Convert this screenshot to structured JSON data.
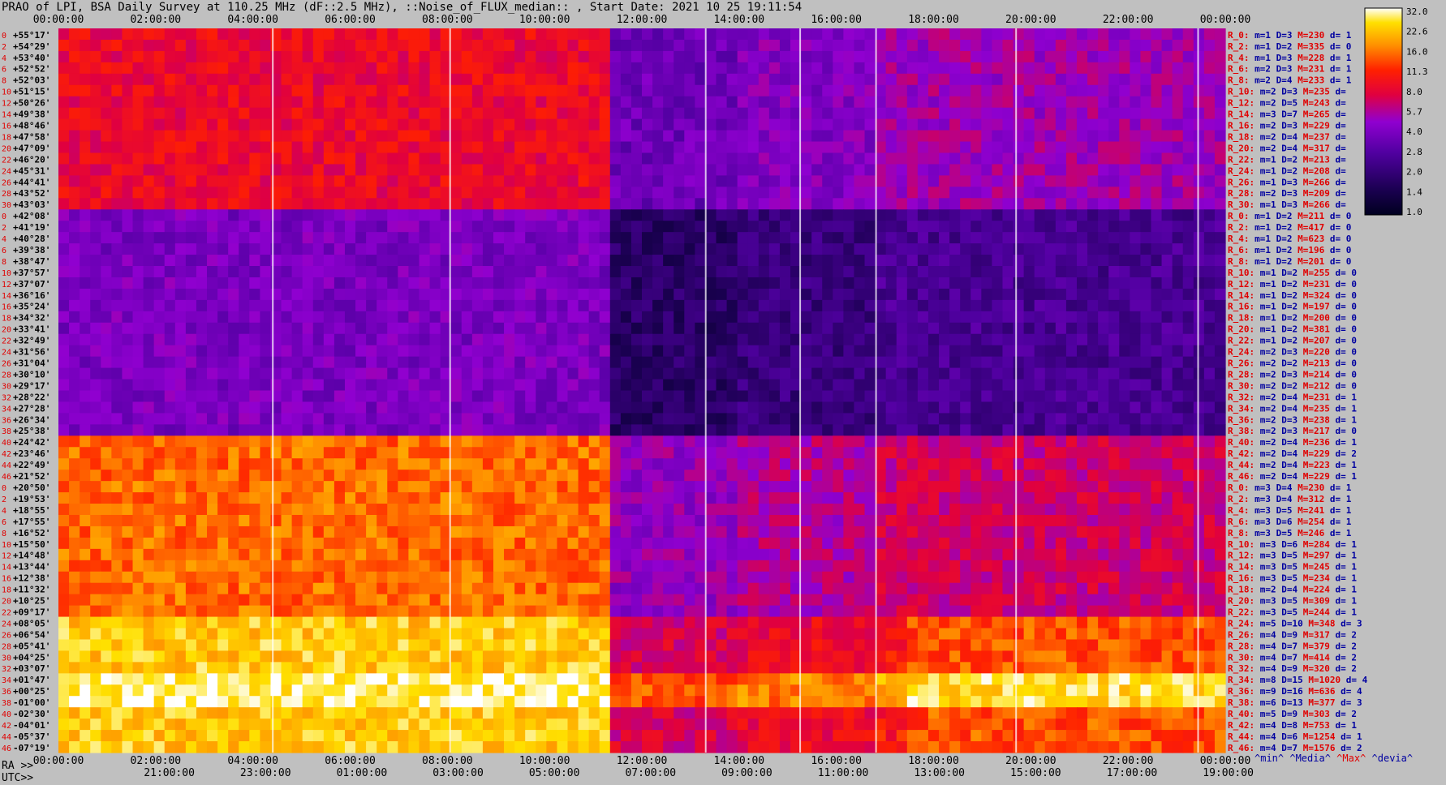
{
  "title": "PRAO of LPI, BSA Daily Survey at 110.25 MHz (dF::2.5 MHz), ::Noise_of_FLUX_median:: , Start Date: 2021 10 25 19:11:54",
  "footer": {
    "ra_label": "RA >>",
    "utc_label": "UTC>>",
    "legend": {
      "min": "^min^",
      "media": "^Media^",
      "max": "^Max^",
      "devia": "^devia^"
    }
  },
  "colors": {
    "background": "#c0c0c0",
    "stat_red": "#e00000",
    "stat_blue": "#0000a0"
  },
  "chart_data": {
    "type": "heatmap",
    "title": "PRAO of LPI, BSA Daily Survey at 110.25 MHz (dF::2.5 MHz), ::Noise_of_FLUX_median:: , Start Date: 2021 10 25 19:11:54",
    "x_top_ticks": [
      "00:00:00",
      "02:00:00",
      "04:00:00",
      "06:00:00",
      "08:00:00",
      "10:00:00",
      "12:00:00",
      "14:00:00",
      "16:00:00",
      "18:00:00",
      "20:00:00",
      "22:00:00",
      "00:00:00"
    ],
    "x_bottom_ra_ticks": [
      "00:00:00",
      "02:00:00",
      "04:00:00",
      "06:00:00",
      "08:00:00",
      "10:00:00",
      "12:00:00",
      "14:00:00",
      "16:00:00",
      "18:00:00",
      "20:00:00",
      "22:00:00",
      "00:00:00"
    ],
    "x_bottom_utc_ticks": [
      "21:00:00",
      "23:00:00",
      "01:00:00",
      "03:00:00",
      "05:00:00",
      "07:00:00",
      "09:00:00",
      "11:00:00",
      "13:00:00",
      "15:00:00",
      "17:00:00",
      "19:00:00"
    ],
    "colorbar": {
      "ticks": [
        "32.0",
        "22.6",
        "16.0",
        "11.3",
        "8.0",
        "5.7",
        "4.0",
        "2.8",
        "2.0",
        "1.4",
        "1.0"
      ],
      "range": [
        1.0,
        32.0
      ]
    },
    "rows": [
      {
        "idx": "0",
        "dec": "+55°17'",
        "R": "R_0:",
        "m": "m=1",
        "D": "D=3",
        "M": "M=230",
        "d": "d= 1",
        "band": 1
      },
      {
        "idx": "2",
        "dec": "+54°29'",
        "R": "R_2:",
        "m": "m=1",
        "D": "D=2",
        "M": "M=335",
        "d": "d= 0",
        "band": 1
      },
      {
        "idx": "4",
        "dec": "+53°40'",
        "R": "R_4:",
        "m": "m=1",
        "D": "D=3",
        "M": "M=228",
        "d": "d= 1",
        "band": 1
      },
      {
        "idx": "6",
        "dec": "+52°52'",
        "R": "R_6:",
        "m": "m=2",
        "D": "D=3",
        "M": "M=231",
        "d": "d= 1",
        "band": 1
      },
      {
        "idx": "8",
        "dec": "+52°03'",
        "R": "R_8:",
        "m": "m=2",
        "D": "D=4",
        "M": "M=233",
        "d": "d= 1",
        "band": 1
      },
      {
        "idx": "10",
        "dec": "+51°15'",
        "R": "R_10:",
        "m": "m=2",
        "D": "D=3",
        "M": "M=235",
        "d": "d=",
        "band": 1
      },
      {
        "idx": "12",
        "dec": "+50°26'",
        "R": "R_12:",
        "m": "m=2",
        "D": "D=5",
        "M": "M=243",
        "d": "d=",
        "band": 1
      },
      {
        "idx": "14",
        "dec": "+49°38'",
        "R": "R_14:",
        "m": "m=3",
        "D": "D=7",
        "M": "M=265",
        "d": "d=",
        "band": 1
      },
      {
        "idx": "16",
        "dec": "+48°46'",
        "R": "R_16:",
        "m": "m=2",
        "D": "D=3",
        "M": "M=229",
        "d": "d=",
        "band": 1
      },
      {
        "idx": "18",
        "dec": "+47°58'",
        "R": "R_18:",
        "m": "m=2",
        "D": "D=4",
        "M": "M=237",
        "d": "d=",
        "band": 1
      },
      {
        "idx": "20",
        "dec": "+47°09'",
        "R": "R_20:",
        "m": "m=2",
        "D": "D=4",
        "M": "M=317",
        "d": "d=",
        "band": 1
      },
      {
        "idx": "22",
        "dec": "+46°20'",
        "R": "R_22:",
        "m": "m=1",
        "D": "D=2",
        "M": "M=213",
        "d": "d=",
        "band": 1
      },
      {
        "idx": "24",
        "dec": "+45°31'",
        "R": "R_24:",
        "m": "m=1",
        "D": "D=2",
        "M": "M=208",
        "d": "d=",
        "band": 1
      },
      {
        "idx": "26",
        "dec": "+44°41'",
        "R": "R_26:",
        "m": "m=1",
        "D": "D=3",
        "M": "M=266",
        "d": "d=",
        "band": 1
      },
      {
        "idx": "28",
        "dec": "+43°52'",
        "R": "R_28:",
        "m": "m=2",
        "D": "D=3",
        "M": "M=209",
        "d": "d=",
        "band": 1
      },
      {
        "idx": "30",
        "dec": "+43°03'",
        "R": "R_30:",
        "m": "m=1",
        "D": "D=3",
        "M": "M=266",
        "d": "d=",
        "band": 1
      },
      {
        "idx": "0",
        "dec": "+42°08'",
        "R": "R_0:",
        "m": "m=1",
        "D": "D=2",
        "M": "M=211",
        "d": "d= 0",
        "band": 2
      },
      {
        "idx": "2",
        "dec": "+41°19'",
        "R": "R_2:",
        "m": "m=1",
        "D": "D=2",
        "M": "M=417",
        "d": "d= 0",
        "band": 2
      },
      {
        "idx": "4",
        "dec": "+40°28'",
        "R": "R_4:",
        "m": "m=1",
        "D": "D=2",
        "M": "M=623",
        "d": "d= 0",
        "band": 2
      },
      {
        "idx": "6",
        "dec": "+39°38'",
        "R": "R_6:",
        "m": "m=1",
        "D": "D=2",
        "M": "M=196",
        "d": "d= 0",
        "band": 2
      },
      {
        "idx": "8",
        "dec": "+38°47'",
        "R": "R_8:",
        "m": "m=1",
        "D": "D=2",
        "M": "M=201",
        "d": "d= 0",
        "band": 2
      },
      {
        "idx": "10",
        "dec": "+37°57'",
        "R": "R_10:",
        "m": "m=1",
        "D": "D=2",
        "M": "M=255",
        "d": "d= 0",
        "band": 2
      },
      {
        "idx": "12",
        "dec": "+37°07'",
        "R": "R_12:",
        "m": "m=1",
        "D": "D=2",
        "M": "M=231",
        "d": "d= 0",
        "band": 2
      },
      {
        "idx": "14",
        "dec": "+36°16'",
        "R": "R_14:",
        "m": "m=1",
        "D": "D=2",
        "M": "M=324",
        "d": "d= 0",
        "band": 2
      },
      {
        "idx": "16",
        "dec": "+35°24'",
        "R": "R_16:",
        "m": "m=1",
        "D": "D=2",
        "M": "M=197",
        "d": "d= 0",
        "band": 2
      },
      {
        "idx": "18",
        "dec": "+34°32'",
        "R": "R_18:",
        "m": "m=1",
        "D": "D=2",
        "M": "M=200",
        "d": "d= 0",
        "band": 2
      },
      {
        "idx": "20",
        "dec": "+33°41'",
        "R": "R_20:",
        "m": "m=1",
        "D": "D=2",
        "M": "M=381",
        "d": "d= 0",
        "band": 2
      },
      {
        "idx": "22",
        "dec": "+32°49'",
        "R": "R_22:",
        "m": "m=1",
        "D": "D=2",
        "M": "M=207",
        "d": "d= 0",
        "band": 2
      },
      {
        "idx": "24",
        "dec": "+31°56'",
        "R": "R_24:",
        "m": "m=2",
        "D": "D=3",
        "M": "M=220",
        "d": "d= 0",
        "band": 2
      },
      {
        "idx": "26",
        "dec": "+31°04'",
        "R": "R_26:",
        "m": "m=2",
        "D": "D=2",
        "M": "M=213",
        "d": "d= 0",
        "band": 2
      },
      {
        "idx": "28",
        "dec": "+30°10'",
        "R": "R_28:",
        "m": "m=2",
        "D": "D=3",
        "M": "M=214",
        "d": "d= 0",
        "band": 2
      },
      {
        "idx": "30",
        "dec": "+29°17'",
        "R": "R_30:",
        "m": "m=2",
        "D": "D=2",
        "M": "M=212",
        "d": "d= 0",
        "band": 2
      },
      {
        "idx": "32",
        "dec": "+28°22'",
        "R": "R_32:",
        "m": "m=2",
        "D": "D=4",
        "M": "M=231",
        "d": "d= 1",
        "band": 2
      },
      {
        "idx": "34",
        "dec": "+27°28'",
        "R": "R_34:",
        "m": "m=2",
        "D": "D=4",
        "M": "M=235",
        "d": "d= 1",
        "band": 2
      },
      {
        "idx": "36",
        "dec": "+26°34'",
        "R": "R_36:",
        "m": "m=2",
        "D": "D=3",
        "M": "M=238",
        "d": "d= 1",
        "band": 2
      },
      {
        "idx": "38",
        "dec": "+25°38'",
        "R": "R_38:",
        "m": "m=2",
        "D": "D=3",
        "M": "M=217",
        "d": "d= 0",
        "band": 2
      },
      {
        "idx": "40",
        "dec": "+24°42'",
        "R": "R_40:",
        "m": "m=2",
        "D": "D=4",
        "M": "M=236",
        "d": "d= 1",
        "band": 3
      },
      {
        "idx": "42",
        "dec": "+23°46'",
        "R": "R_42:",
        "m": "m=2",
        "D": "D=4",
        "M": "M=229",
        "d": "d= 2",
        "band": 3
      },
      {
        "idx": "44",
        "dec": "+22°49'",
        "R": "R_44:",
        "m": "m=2",
        "D": "D=4",
        "M": "M=223",
        "d": "d= 1",
        "band": 3
      },
      {
        "idx": "46",
        "dec": "+21°52'",
        "R": "R_46:",
        "m": "m=2",
        "D": "D=4",
        "M": "M=229",
        "d": "d= 1",
        "band": 3
      },
      {
        "idx": "0",
        "dec": "+20°50'",
        "R": "R_0:",
        "m": "m=3",
        "D": "D=4",
        "M": "M=230",
        "d": "d= 1",
        "band": 3
      },
      {
        "idx": "2",
        "dec": "+19°53'",
        "R": "R_2:",
        "m": "m=3",
        "D": "D=4",
        "M": "M=312",
        "d": "d= 1",
        "band": 3
      },
      {
        "idx": "4",
        "dec": "+18°55'",
        "R": "R_4:",
        "m": "m=3",
        "D": "D=5",
        "M": "M=241",
        "d": "d= 1",
        "band": 3
      },
      {
        "idx": "6",
        "dec": "+17°55'",
        "R": "R_6:",
        "m": "m=3",
        "D": "D=6",
        "M": "M=254",
        "d": "d= 1",
        "band": 3
      },
      {
        "idx": "8",
        "dec": "+16°52'",
        "R": "R_8:",
        "m": "m=3",
        "D": "D=5",
        "M": "M=246",
        "d": "d= 1",
        "band": 3
      },
      {
        "idx": "10",
        "dec": "+15°50'",
        "R": "R_10:",
        "m": "m=3",
        "D": "D=6",
        "M": "M=284",
        "d": "d= 1",
        "band": 3
      },
      {
        "idx": "12",
        "dec": "+14°48'",
        "R": "R_12:",
        "m": "m=3",
        "D": "D=5",
        "M": "M=297",
        "d": "d= 1",
        "band": 3
      },
      {
        "idx": "14",
        "dec": "+13°44'",
        "R": "R_14:",
        "m": "m=3",
        "D": "D=5",
        "M": "M=245",
        "d": "d= 1",
        "band": 3
      },
      {
        "idx": "16",
        "dec": "+12°38'",
        "R": "R_16:",
        "m": "m=3",
        "D": "D=5",
        "M": "M=234",
        "d": "d= 1",
        "band": 3
      },
      {
        "idx": "18",
        "dec": "+11°32'",
        "R": "R_18:",
        "m": "m=2",
        "D": "D=4",
        "M": "M=224",
        "d": "d= 1",
        "band": 3
      },
      {
        "idx": "20",
        "dec": "+10°25'",
        "R": "R_20:",
        "m": "m=3",
        "D": "D=5",
        "M": "M=309",
        "d": "d= 1",
        "band": 3
      },
      {
        "idx": "22",
        "dec": "+09°17'",
        "R": "R_22:",
        "m": "m=3",
        "D": "D=5",
        "M": "M=244",
        "d": "d= 1",
        "band": 3
      },
      {
        "idx": "24",
        "dec": "+08°05'",
        "R": "R_24:",
        "m": "m=5",
        "D": "D=10",
        "M": "M=348",
        "d": "d= 3",
        "band": 4
      },
      {
        "idx": "26",
        "dec": "+06°54'",
        "R": "R_26:",
        "m": "m=4",
        "D": "D=9",
        "M": "M=317",
        "d": "d= 2",
        "band": 4
      },
      {
        "idx": "28",
        "dec": "+05°41'",
        "R": "R_28:",
        "m": "m=4",
        "D": "D=7",
        "M": "M=379",
        "d": "d= 2",
        "band": 4
      },
      {
        "idx": "30",
        "dec": "+04°25'",
        "R": "R_30:",
        "m": "m=4",
        "D": "D=7",
        "M": "M=414",
        "d": "d= 2",
        "band": 4
      },
      {
        "idx": "32",
        "dec": "+03°07'",
        "R": "R_32:",
        "m": "m=4",
        "D": "D=9",
        "M": "M=320",
        "d": "d= 2",
        "band": 4
      },
      {
        "idx": "34",
        "dec": "+01°47'",
        "R": "R_34:",
        "m": "m=8",
        "D": "D=15",
        "M": "M=1020",
        "d": "d= 4",
        "band": 5
      },
      {
        "idx": "36",
        "dec": "+00°25'",
        "R": "R_36:",
        "m": "m=9",
        "D": "D=16",
        "M": "M=636",
        "d": "d= 4",
        "band": 5
      },
      {
        "idx": "38",
        "dec": "-01°00'",
        "R": "R_38:",
        "m": "m=6",
        "D": "D=13",
        "M": "M=377",
        "d": "d= 3",
        "band": 5
      },
      {
        "idx": "40",
        "dec": "-02°30'",
        "R": "R_40:",
        "m": "m=5",
        "D": "D=9",
        "M": "M=303",
        "d": "d= 2",
        "band": 4
      },
      {
        "idx": "42",
        "dec": "-04°01'",
        "R": "R_42:",
        "m": "m=4",
        "D": "D=8",
        "M": "M=753",
        "d": "d= 1",
        "band": 4
      },
      {
        "idx": "44",
        "dec": "-05°37'",
        "R": "R_44:",
        "m": "m=4",
        "D": "D=6",
        "M": "M=1254",
        "d": "d= 1",
        "band": 4
      },
      {
        "idx": "46",
        "dec": "-07°19'",
        "R": "R_46:",
        "m": "m=4",
        "D": "D=7",
        "M": "M=1576",
        "d": "d= 2",
        "band": 4
      }
    ]
  }
}
